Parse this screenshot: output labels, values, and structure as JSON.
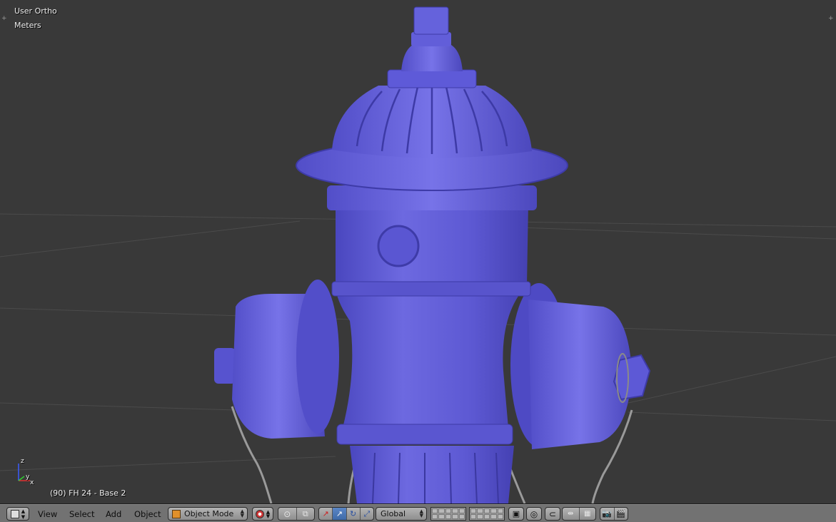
{
  "viewport": {
    "view_name": "User Ortho",
    "units": "Meters",
    "object_info": "(90) FH 24 - Base 2",
    "axis": {
      "z": "z",
      "y": "y",
      "x": "x"
    },
    "colors": {
      "background": "#393939",
      "hydrant": "#5f5bd6",
      "grid": "#4a4a4a"
    }
  },
  "header": {
    "editor_type_icon": "cube-icon",
    "menus": {
      "view": "View",
      "select": "Select",
      "add": "Add",
      "object": "Object"
    },
    "mode": {
      "label": "Object Mode",
      "icon": "object-mode-cube-icon"
    },
    "orientation": {
      "label": "Global"
    },
    "icons": [
      "viewport-shading-icon",
      "pivot-point-icon",
      "manipulator-toggle-icon",
      "translate-manipulator-icon",
      "rotate-manipulator-icon",
      "scale-manipulator-icon",
      "layers-icon",
      "lock-layers-icon",
      "proportional-edit-icon",
      "snap-icon",
      "snap-element-icon",
      "snap-target-icon",
      "render-icon",
      "render-animation-icon"
    ]
  }
}
